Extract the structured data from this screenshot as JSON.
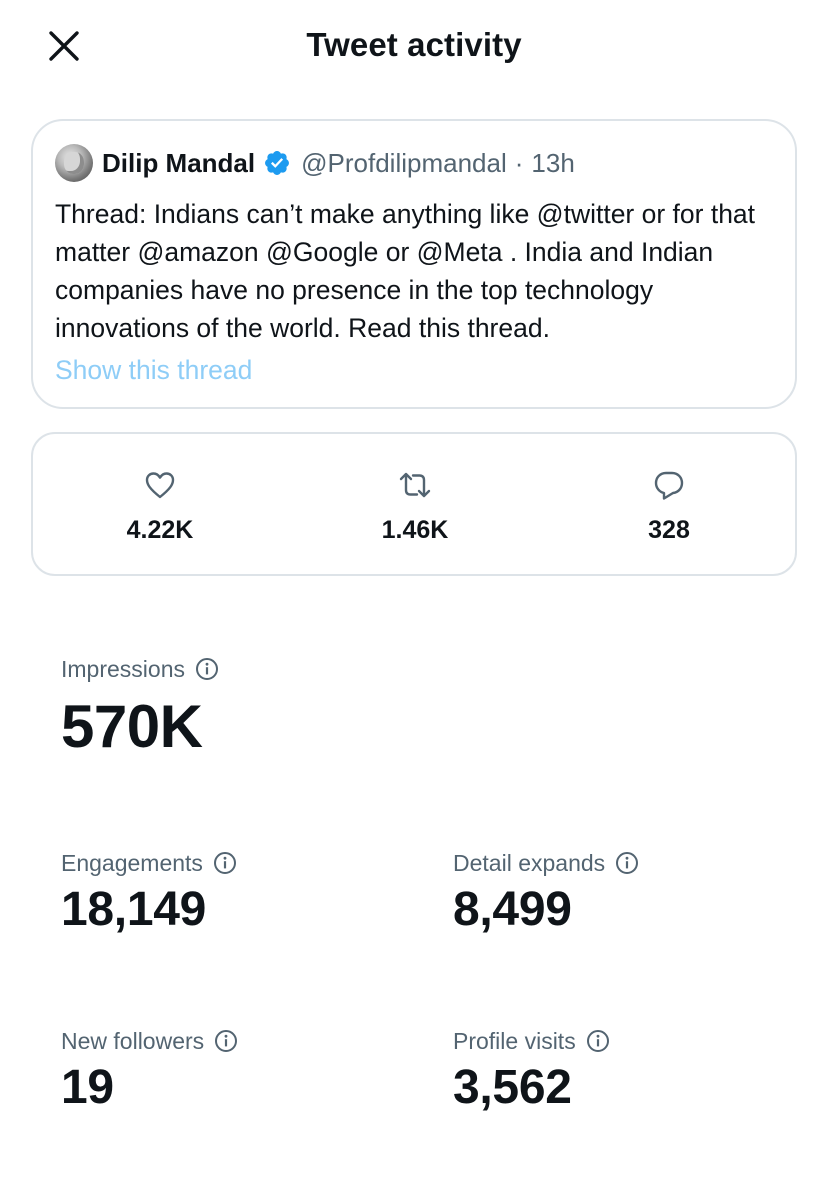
{
  "header": {
    "title": "Tweet activity"
  },
  "tweet": {
    "author_name": "Dilip Mandal",
    "handle": "@Profdilipmandal",
    "separator": "·",
    "time": "13h",
    "text": "Thread: Indians can’t make anything like @twitter or for that matter @amazon @Google or @Meta . India and Indian companies have no presence in the top technology innovations of the world. Read this thread.",
    "show_thread_label": "Show this thread"
  },
  "stats": {
    "likes": "4.22K",
    "retweets": "1.46K",
    "replies": "328"
  },
  "metrics": {
    "impressions": {
      "label": "Impressions",
      "value": "570K"
    },
    "engagements": {
      "label": "Engagements",
      "value": "18,149"
    },
    "detail_expands": {
      "label": "Detail expands",
      "value": "8,499"
    },
    "new_followers": {
      "label": "New followers",
      "value": "19"
    },
    "profile_visits": {
      "label": "Profile visits",
      "value": "3,562"
    }
  },
  "colors": {
    "text_primary": "#0f1419",
    "text_secondary": "#536471",
    "link_muted": "#8ecdf7",
    "verified_badge": "#1d9bf0",
    "card_border": "#dde3e8"
  },
  "icons": {
    "close": "close-icon",
    "verified": "verified-badge-icon",
    "likes": "heart-icon",
    "retweets": "retweet-icon",
    "replies": "reply-icon",
    "info": "info-icon"
  }
}
